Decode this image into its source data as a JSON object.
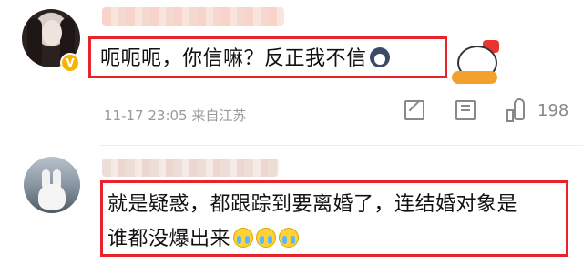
{
  "comments": [
    {
      "text": "呃呃呃，你信嘛？反正我不信",
      "emoji_inline": "husky-emoji",
      "sticker": "pig-sticker",
      "meta": "11-17 23:05 来自江苏",
      "like_count": "198",
      "verified": true
    },
    {
      "text_line1": "就是疑惑，都跟踪到要离婚了，连结婚对象是",
      "text_line2": "谁都没爆出来",
      "emoji_trail": [
        "cry-laugh-emoji",
        "cry-laugh-emoji",
        "cry-laugh-emoji"
      ]
    }
  ],
  "colors": {
    "highlight": "#e8232a",
    "meta_text": "#9a9a9a",
    "verified_badge": "#f7b500"
  },
  "icons": [
    "share-icon",
    "reply-icon",
    "like-icon",
    "verified-badge-icon"
  ],
  "verified_badge_text": "V"
}
